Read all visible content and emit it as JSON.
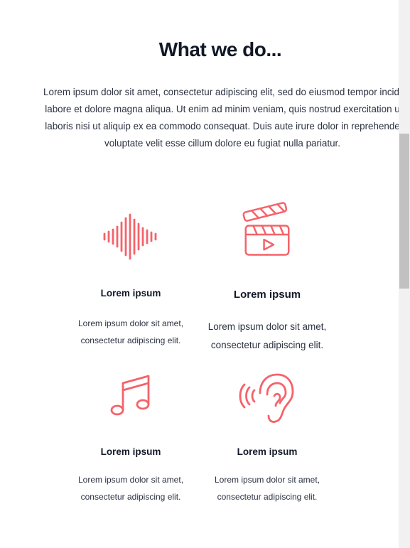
{
  "header": {
    "title": "What we do..."
  },
  "intro": {
    "text": "Lorem ipsum dolor sit amet, consectetur adipiscing elit, sed do eiusmod tempor incidi\nlabore et dolore magna aliqua. Ut enim ad minim veniam, quis nostrud exercitation u\nlaboris nisi ut aliquip ex ea commodo consequat. Duis aute irure dolor in reprehende\nvoluptate velit esse cillum dolore eu fugiat nulla pariatur."
  },
  "services": [
    {
      "icon": "sound-wave-icon",
      "title": "Lorem ipsum",
      "text": "Lorem ipsum dolor sit amet,\nconsectetur adipiscing elit."
    },
    {
      "icon": "clapperboard-icon",
      "title": "Lorem ipsum",
      "text": "Lorem ipsum dolor sit amet,\nconsectetur adipiscing elit."
    },
    {
      "icon": "music-note-icon",
      "title": "Lorem ipsum",
      "text": "Lorem ipsum dolor sit amet,\nconsectetur adipiscing elit."
    },
    {
      "icon": "ear-listening-icon",
      "title": "Lorem ipsum",
      "text": "Lorem ipsum dolor sit amet,\nconsectetur adipiscing elit."
    }
  ],
  "theme": {
    "accent_color": "#f5626a",
    "heading_color": "#111827",
    "text_color": "#2b3140",
    "scrollbar_track": "#f1f1f1",
    "scrollbar_thumb": "#c1c1c1"
  }
}
